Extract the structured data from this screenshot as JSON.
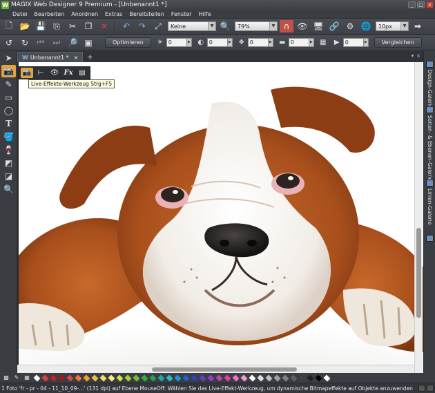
{
  "window": {
    "title": "MAGIX Web Designer 9 Premium - [Unbenannt1 *]",
    "logo_letter": "W",
    "minimize": "_",
    "maximize": "□",
    "close": "x"
  },
  "menu": [
    "Datei",
    "Bearbeiten",
    "Anordnen",
    "Extras",
    "Bereitstellen",
    "Fenster",
    "Hilfe"
  ],
  "toolbar1": {
    "blend_mode": "Keine",
    "zoom": "79%",
    "size_value": "10px"
  },
  "toolbar2": {
    "optimize_label": "Optimieren",
    "value1": "0",
    "value2": "0",
    "value3": "0",
    "value4": "0",
    "value5": "0",
    "compare_label": "Vergleichen"
  },
  "tabs": {
    "doc_tab_icon": "W",
    "doc_tab_label": "Unbenannt1 *",
    "doc_tab_close": "×",
    "add_tab": "+",
    "panel_ctrl_dropdown": "▾",
    "panel_ctrl_close": "×"
  },
  "live_toolbar": {
    "fx_label": "Fx",
    "tooltip": "Live-Effekte-Werkzeug  Strg+F5"
  },
  "right_panel": {
    "design_gallery": "Design-Galerie",
    "pages_layers_gallery": "Seiten- & Ebenen-Galerie",
    "lines_gallery": "Linien-Galerie"
  },
  "palette_colors": [
    "#ffffff",
    "#e24040",
    "#c62020",
    "#a01818",
    "#d04848",
    "#e87a3a",
    "#f0a030",
    "#e8c050",
    "#f4e060",
    "#f8f080",
    "#d8e040",
    "#a8d030",
    "#70c030",
    "#30b040",
    "#20a060",
    "#20a8a0",
    "#20c0d0",
    "#2090e0",
    "#2060d0",
    "#3040c0",
    "#6040c0",
    "#9040c0",
    "#c040b0",
    "#e040a0",
    "#f070c0",
    "#f0a0d0",
    "#ffffff",
    "#e0e0e0",
    "#c0c0c0",
    "#a0a0a0",
    "#808080",
    "#606060",
    "#404040",
    "#202020",
    "#000000",
    "#ffffff"
  ],
  "status": {
    "text": "1 Foto 'fr - pr - 04 - 11_10_09-...' (131 dpi) auf Ebene MouseOff: Wählen Sie das Live-Effekt-Werkzeug, um dynamische Bitmapeffekte auf Objekte anzuwenden"
  },
  "accent_color": "#e3a23b",
  "canvas_background": "#ffffff"
}
